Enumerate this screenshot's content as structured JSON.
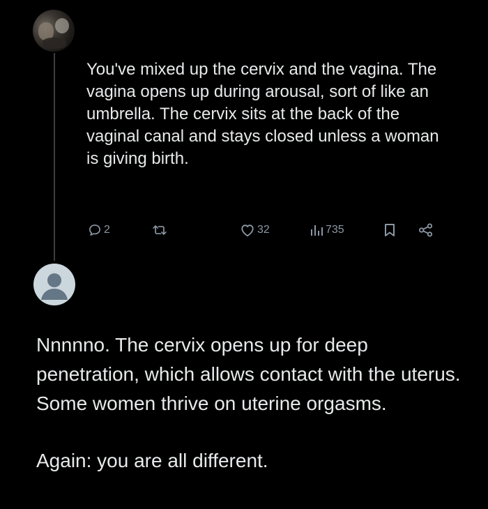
{
  "original_tweet": {
    "avatar_icon": "user-photo-avatar",
    "text": "You've mixed up the cervix and the vagina. The vagina opens up during arousal, sort of like an umbrella. The cervix sits at the back of the vaginal canal and stays closed unless a woman is giving birth.",
    "actions": {
      "reply": {
        "icon": "reply-icon",
        "count": "2"
      },
      "retweet": {
        "icon": "retweet-icon",
        "count": ""
      },
      "like": {
        "icon": "heart-icon",
        "count": "32"
      },
      "views": {
        "icon": "views-icon",
        "count": "735"
      },
      "bookmark": {
        "icon": "bookmark-icon"
      },
      "share": {
        "icon": "share-icon"
      }
    }
  },
  "reply_tweet": {
    "avatar_icon": "default-avatar",
    "paragraphs": [
      "Nnnnno. The cervix opens up for deep penetration, which allows contact with the uterus. Some women thrive on uterine orgasms.",
      "Again: you are all different."
    ]
  },
  "colors": {
    "background": "#000000",
    "text": "#e7e9ea",
    "secondary": "#8b98a5",
    "thread_line": "#3b3f44",
    "default_avatar": "#ccd6dd"
  }
}
